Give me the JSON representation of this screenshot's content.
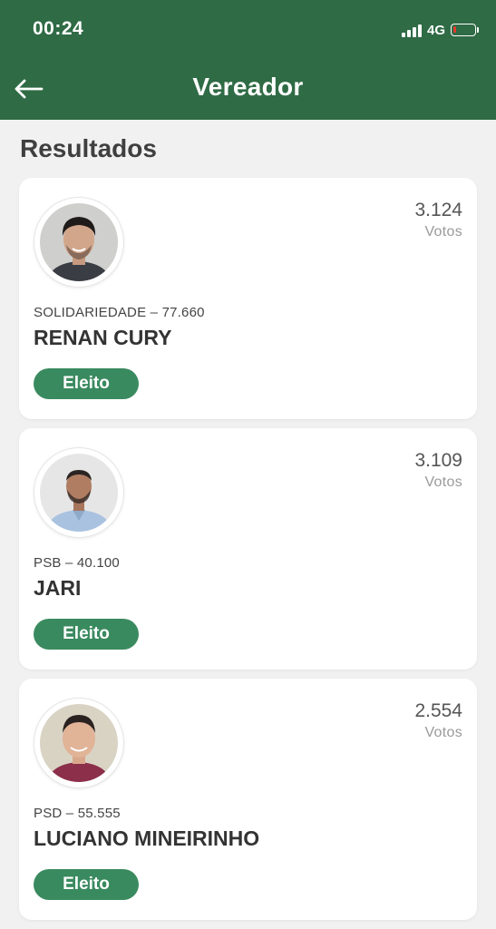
{
  "status_bar": {
    "time": "00:24",
    "network": "4G"
  },
  "header": {
    "title": "Vereador"
  },
  "section": {
    "title": "Resultados"
  },
  "candidates": [
    {
      "votes": "3.124",
      "votes_label": "Votos",
      "party": "SOLIDARIEDADE – 77.660",
      "name": "RENAN CURY",
      "status": "Eleito"
    },
    {
      "votes": "3.109",
      "votes_label": "Votos",
      "party": "PSB – 40.100",
      "name": "JARI",
      "status": "Eleito"
    },
    {
      "votes": "2.554",
      "votes_label": "Votos",
      "party": "PSD – 55.555",
      "name": "LUCIANO MINEIRINHO",
      "status": "Eleito"
    }
  ],
  "colors": {
    "header": "#2f6b45",
    "badge": "#3a8a5f",
    "background": "#f1f1f1",
    "battery_low": "#e33b2e"
  },
  "icons": [
    "back-arrow-icon",
    "signal-icon",
    "battery-icon"
  ]
}
